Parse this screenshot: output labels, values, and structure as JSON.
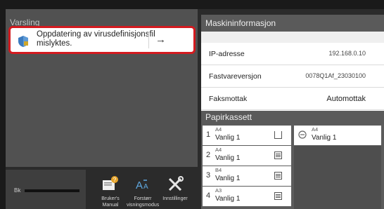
{
  "notification": {
    "header": "Varsling",
    "message": "Oppdatering av virusdefinisjonsfil mislyktes.",
    "arrow": "→",
    "accent": "#d31a1f"
  },
  "toner": {
    "label": "Bk"
  },
  "shortcuts": [
    {
      "icon": "manual-icon",
      "label": "Bruker's Manual"
    },
    {
      "icon": "zoom-text-icon",
      "label": "Forstørr visningsmodus"
    },
    {
      "icon": "tools-icon",
      "label": "Innstillinger"
    }
  ],
  "machine_info": {
    "header": "Maskininformasjon",
    "rows": [
      {
        "key": "IP-adresse",
        "value": "192.168.0.10"
      },
      {
        "key": "Fastvareversjon",
        "value": "0078Q1Af_23030100"
      },
      {
        "key": "Faksmottak",
        "value": "Automottak"
      }
    ]
  },
  "paper": {
    "header": "Papirkassett",
    "trays": [
      {
        "num": "1",
        "size": "A4",
        "type": "Vanlig 1"
      },
      {
        "num": "2",
        "size": "A4",
        "type": "Vanlig 1"
      },
      {
        "num": "3",
        "size": "B4",
        "type": "Vanlig 1"
      },
      {
        "num": "4",
        "size": "A3",
        "type": "Vanlig 1"
      }
    ],
    "bypass": {
      "size": "A4",
      "type": "Vanlig 1"
    }
  }
}
